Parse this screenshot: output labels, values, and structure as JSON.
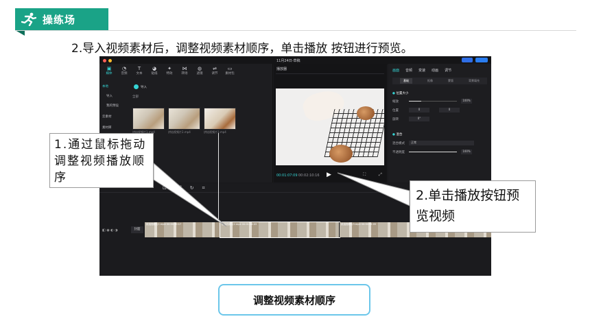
{
  "header": {
    "badge_text": "操练场",
    "badge_icon": "running-person-icon"
  },
  "instruction": "2.导入视频素材后，调整视频素材顺序，单击播放 按钮进行预览。",
  "app": {
    "window_title": "11月24日-草稿",
    "toolbar": [
      {
        "label": "媒体",
        "icon": "media-icon"
      },
      {
        "label": "音频",
        "icon": "audio-icon"
      },
      {
        "label": "文本",
        "icon": "text-icon"
      },
      {
        "label": "贴纸",
        "icon": "sticker-icon"
      },
      {
        "label": "特效",
        "icon": "effect-icon"
      },
      {
        "label": "转场",
        "icon": "transition-icon"
      },
      {
        "label": "滤镜",
        "icon": "filter-icon"
      },
      {
        "label": "调节",
        "icon": "adjust-icon"
      },
      {
        "label": "素材包",
        "icon": "package-icon"
      }
    ],
    "sidebar": [
      "本地",
      "导入",
      "我的预设",
      "云素材",
      "素材库"
    ],
    "import_label": "导入",
    "section_label": "全部",
    "clips": [
      {
        "name": "烘焙视频片1.mp4"
      },
      {
        "name": "烘焙视频片2.mp4"
      },
      {
        "name": "烘焙视频片3.mp4"
      }
    ],
    "player": {
      "title": "播放器",
      "current_time": "00:01:07:09",
      "total_time": "00:02:10:16"
    },
    "properties": {
      "tabs": [
        "画面",
        "音频",
        "变速",
        "动画",
        "调节"
      ],
      "subtabs": [
        "基础",
        "抠像",
        "蒙版",
        "背景填充"
      ],
      "sections": [
        {
          "label": "位置大小"
        },
        {
          "label": "缩放",
          "value": "100%"
        },
        {
          "label": "位置",
          "x": "0",
          "y": "0"
        },
        {
          "label": "旋转",
          "value": "0°"
        },
        {
          "label": "混合"
        },
        {
          "label": "混合模式",
          "value": "正常"
        },
        {
          "label": "不透明度",
          "value": "100%"
        }
      ]
    },
    "timeline": {
      "track_label": "封面",
      "clips": [
        {
          "label": "烘焙视频片1.mp4 00:00:30:17"
        },
        {
          "label": "烘焙视频片2.mp4 00:01:04:03"
        },
        {
          "label": "烘焙视频片3.mp4 00:00:55:05"
        }
      ]
    }
  },
  "callouts": {
    "drag_text": "1.通过鼠标拖动调整视频播放顺序",
    "play_text": "2.单击播放按钮预览视频"
  },
  "caption": "调整视频素材顺序"
}
